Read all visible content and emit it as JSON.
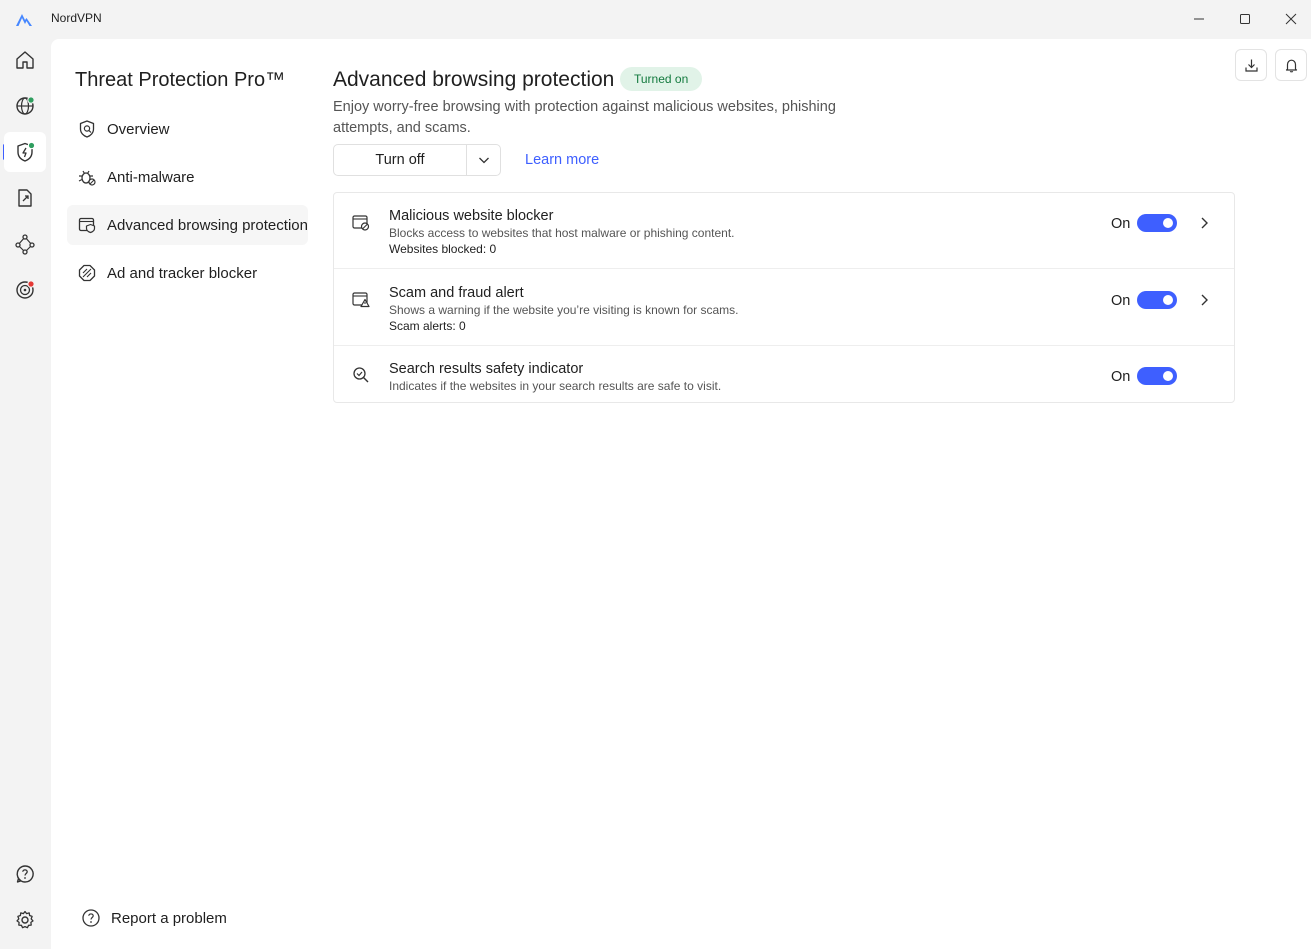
{
  "window": {
    "title": "NordVPN"
  },
  "rail": {
    "items": [
      {
        "name": "home-icon"
      },
      {
        "name": "globe-icon",
        "dot_color": "#2f9e5f"
      },
      {
        "name": "threat-protection-icon",
        "dot_color": "#2f9e5f",
        "active": true
      },
      {
        "name": "file-share-icon"
      },
      {
        "name": "meshnet-icon"
      },
      {
        "name": "dark-web-monitor-icon",
        "dot_color": "#e53935"
      }
    ],
    "bottom": [
      {
        "name": "help-icon"
      },
      {
        "name": "settings-icon"
      }
    ]
  },
  "subnav": {
    "title": "Threat Protection Pro™",
    "items": [
      {
        "label": "Overview",
        "icon": "shield-search-icon"
      },
      {
        "label": "Anti-malware",
        "icon": "bug-icon"
      },
      {
        "label": "Advanced browsing protection",
        "icon": "browser-shield-icon",
        "active": true
      },
      {
        "label": "Ad and tracker blocker",
        "icon": "ad-block-icon"
      }
    ],
    "report_label": "Report a problem"
  },
  "main": {
    "title": "Advanced browsing protection",
    "status_badge": "Turned on",
    "description": "Enjoy worry-free browsing with protection against malicious websites, phishing attempts, and scams.",
    "turn_off_label": "Turn off",
    "learn_more_label": "Learn more",
    "features": [
      {
        "title": "Malicious website blocker",
        "description": "Blocks access to websites that host malware or phishing content.",
        "stat": "Websites blocked: 0",
        "toggle_label": "On",
        "enabled": true
      },
      {
        "title": "Scam and fraud alert",
        "description": "Shows a warning if the website you’re visiting is known for scams.",
        "stat": "Scam alerts: 0",
        "toggle_label": "On",
        "enabled": true
      },
      {
        "title": "Search results safety indicator",
        "description": "Indicates if the websites in your search results are safe to visit.",
        "toggle_label": "On",
        "enabled": true
      }
    ]
  },
  "colors": {
    "accent": "#3e5fff",
    "badge_bg": "#e1f3e8",
    "badge_text": "#137a3e"
  }
}
